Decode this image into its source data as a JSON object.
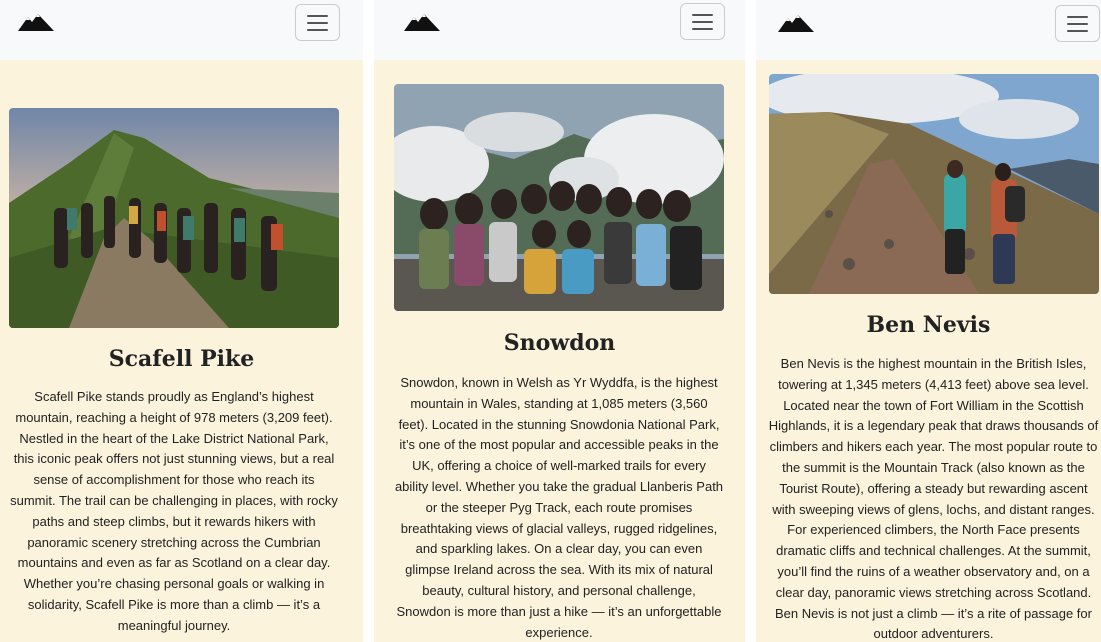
{
  "panels": [
    {
      "logo_icon": "mountain-logo-icon",
      "menu_icon": "hamburger-menu-icon",
      "title": "Scafell Pike",
      "text": "Scafell Pike stands proudly as England’s highest mountain, reaching a height of 978 meters (3,209 feet). Nestled in the heart of the Lake District National Park, this iconic peak offers not just stunning views, but a real sense of accomplishment for those who reach its summit. The trail can be challenging in places, with rocky paths and steep climbs, but it rewards hikers with panoramic scenery stretching across the Cumbrian mountains and even as far as Scotland on a clear day. Whether you’re chasing personal goals or walking in solidarity, Scafell Pike is more than a climb — it’s a meaningful journey."
    },
    {
      "logo_icon": "mountain-logo-icon",
      "menu_icon": "hamburger-menu-icon",
      "title": "Snowdon",
      "text": "Snowdon, known in Welsh as Yr Wyddfa, is the highest mountain in Wales, standing at 1,085 meters (3,560 feet). Located in the stunning Snowdonia National Park, it’s one of the most popular and accessible peaks in the UK, offering a choice of well-marked trails for every ability level. Whether you take the gradual Llanberis Path or the steeper Pyg Track, each route promises breathtaking views of glacial valleys, rugged ridgelines, and sparkling lakes. On a clear day, you can even glimpse Ireland across the sea. With its mix of natural beauty, cultural history, and personal challenge, Snowdon is more than just a hike — it’s an unforgettable experience."
    },
    {
      "logo_icon": "mountain-logo-icon",
      "menu_icon": "hamburger-menu-icon",
      "title": "Ben Nevis",
      "text": "Ben Nevis is the highest mountain in the British Isles, towering at 1,345 meters (4,413 feet) above sea level. Located near the town of Fort William in the Scottish Highlands, it is a legendary peak that draws thousands of climbers and hikers each year. The most popular route to the summit is the Mountain Track (also known as the Tourist Route), offering a steady but rewarding ascent with sweeping views of glens, lochs, and distant ranges. For experienced climbers, the North Face presents dramatic cliffs and technical challenges. At the summit, you’ll find the ruins of a weather observatory and, on a clear day, panoramic views stretching across Scotland. Ben Nevis is not just a climb — it’s a rite of passage for outdoor adventurers."
    }
  ],
  "colors": {
    "panel_bg": "#fcf3dd",
    "navbar_bg": "#f8f9fb",
    "text": "#222222"
  }
}
